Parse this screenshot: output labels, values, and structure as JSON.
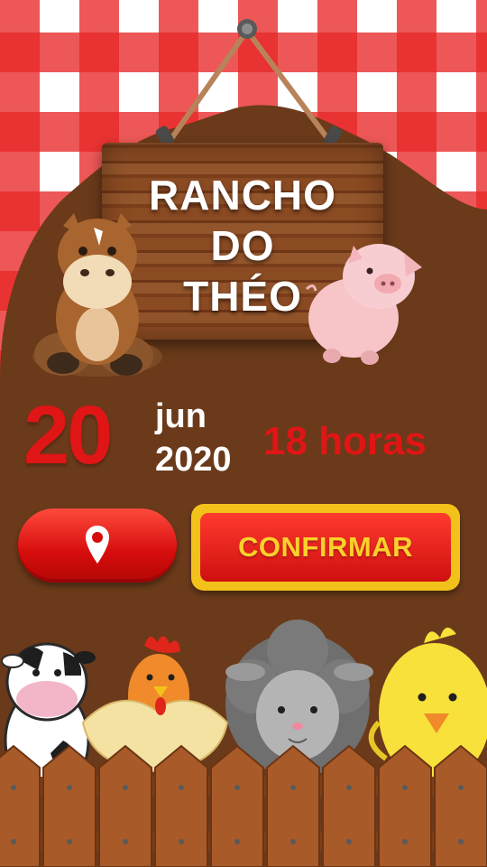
{
  "sign": {
    "lines": [
      "RANCHO",
      "DO",
      "THÉO"
    ]
  },
  "event": {
    "day": "20",
    "month": "jun",
    "year": "2020",
    "time": "18 horas"
  },
  "actions": {
    "location_icon": "map-pin-icon",
    "confirm_label": "CONFIRMAR"
  },
  "colors": {
    "red": "#e01515",
    "brown": "#6a3a1a",
    "yellow": "#f2c21b",
    "check_red": "#e82828"
  }
}
